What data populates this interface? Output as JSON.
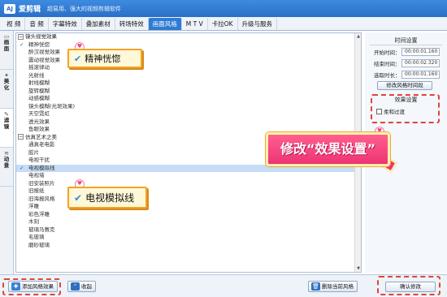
{
  "app": {
    "logo": "AJ",
    "name": "爱剪辑",
    "slogan": "超易用、强大的视频剪辑软件"
  },
  "tabs": [
    "视 频",
    "音 频",
    "字幕特效",
    "叠加素材",
    "转场特效",
    "画面风格",
    "M T V",
    "卡拉OK",
    "升级与服务"
  ],
  "active_tab": "画面风格",
  "sidebar": {
    "items": [
      {
        "label": "画面",
        "icon": "picture-icon"
      },
      {
        "label": "美化",
        "icon": "wand-icon"
      },
      {
        "label": "滤镜",
        "icon": "pen-icon"
      },
      {
        "label": "动景",
        "icon": "wave-icon"
      }
    ]
  },
  "list": {
    "groups": [
      {
        "header": "镜头视觉效果",
        "items": [
          "精神恍惚",
          "醉汉视觉效果",
          "震动视觉效果",
          "摇滚律动",
          "光射线",
          "射线模糊",
          "旋转模糊",
          "动感模糊",
          "镜头模糊(光斑效果)",
          "天空霓虹",
          "透光效果",
          "鱼眼效果"
        ]
      },
      {
        "header": "仿真艺术之美",
        "items": [
          "通真老电影",
          "胶片",
          "电视干扰",
          "电视模拟线",
          "电视墙",
          "旧安装照片",
          "旧报纸",
          "旧海报风格",
          "浮雕",
          "彩色浮雕",
          "木刻",
          "玻璃马赛克",
          "毛玻璃",
          "磨砂玻璃"
        ]
      }
    ],
    "checked_items": [
      "精神恍惚",
      "电视模拟线"
    ],
    "selected_item": "电视模拟线"
  },
  "time_settings": {
    "title": "时间设置",
    "start_label": "开始时间：",
    "start_value": "00:00:01.160",
    "end_label": "结束时间：",
    "end_value": "00:00:02.320",
    "duration_label": "选取时长：",
    "duration_value": "00:00:01.160",
    "modify_button": "修改风格时间段"
  },
  "effect_settings": {
    "title": "效果设置",
    "checkbox_label": "柔和过渡"
  },
  "bottom": {
    "add_button": "添加风格效果",
    "collapse_button": "收起",
    "delete_button": "删除当前风格",
    "confirm_button": "确认修改"
  },
  "annotations": {
    "callout1": "精神恍惚",
    "callout2": "电视模拟线",
    "banner": "修改“效果设置”"
  },
  "colors": {
    "titlebar": "#2a6fc7",
    "active_tab": "#2f7bd4",
    "highlight_dash": "#e0443a",
    "callout_border": "#f2a324",
    "banner": "#ee3474"
  }
}
